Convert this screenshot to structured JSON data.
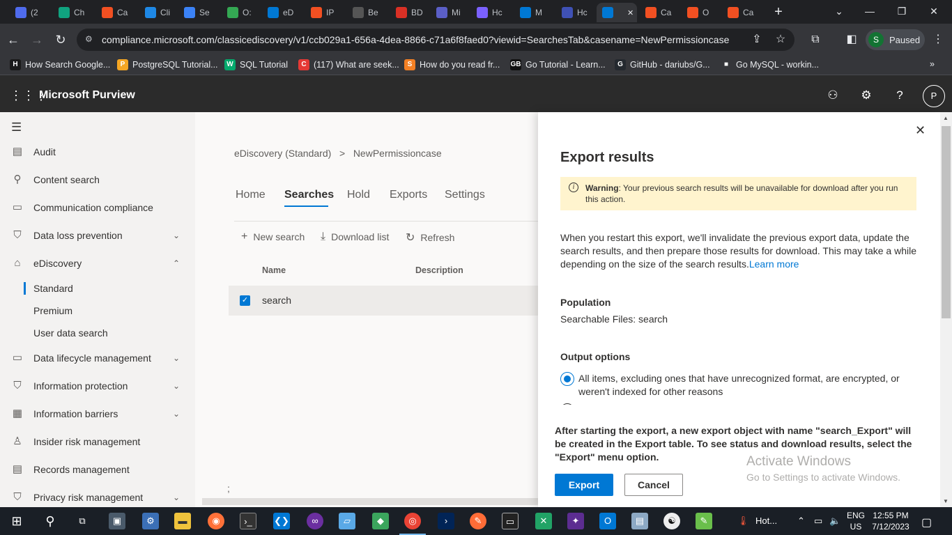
{
  "browser": {
    "tabs": [
      {
        "label": "(2",
        "color": "#4f6bed"
      },
      {
        "label": "Ch",
        "color": "#10a37f"
      },
      {
        "label": "Ca",
        "color": "#f25022"
      },
      {
        "label": "Cli",
        "color": "#1e88e5"
      },
      {
        "label": "Se",
        "color": "#3b82f6"
      },
      {
        "label": "O:",
        "color": "#34a853"
      },
      {
        "label": "eD",
        "color": "#0078d4"
      },
      {
        "label": "IP",
        "color": "#f25022"
      },
      {
        "label": "Be",
        "color": "#555555"
      },
      {
        "label": "BD",
        "color": "#d93025"
      },
      {
        "label": "Mi",
        "color": "#5b5fc7"
      },
      {
        "label": "Hc",
        "color": "#7b61ff"
      },
      {
        "label": "M",
        "color": "#0078d4"
      },
      {
        "label": "Hc",
        "color": "#3f51b5"
      },
      {
        "label": "",
        "color": "#0078d4"
      },
      {
        "label": "Ca",
        "color": "#f25022"
      },
      {
        "label": "O",
        "color": "#f25022"
      },
      {
        "label": "Ca",
        "color": "#f25022"
      }
    ],
    "url": "compliance.microsoft.com/classicediscovery/v1/ccb029a1-656a-4dea-8866-c71a6f8faed0?viewid=SearchesTab&casename=NewPermissioncase",
    "profile": {
      "initial": "S",
      "label": "Paused"
    },
    "bookmarks": [
      {
        "label": "How Search Google...",
        "icon": "H",
        "color": "#1a1a1a"
      },
      {
        "label": "PostgreSQL Tutorial...",
        "icon": "P",
        "color": "#f5a623"
      },
      {
        "label": "SQL Tutorial",
        "icon": "W",
        "color": "#04aa6d"
      },
      {
        "label": "(117) What are seek...",
        "icon": "C",
        "color": "#e53935"
      },
      {
        "label": "How do you read fr...",
        "icon": "S",
        "color": "#f48024"
      },
      {
        "label": "Go Tutorial - Learn...",
        "icon": "GB",
        "color": "#111111"
      },
      {
        "label": "GitHub - dariubs/G...",
        "icon": "G",
        "color": "#24292f"
      },
      {
        "label": "Go MySQL - workin...",
        "icon": "■",
        "color": "#35363a"
      }
    ]
  },
  "app": {
    "title": "Microsoft Purview",
    "avatar": "P"
  },
  "nav": {
    "items": [
      {
        "label": "Audit",
        "icon": "audit-icon",
        "glyph": "▤"
      },
      {
        "label": "Content search",
        "icon": "search-icon",
        "glyph": "⚲"
      },
      {
        "label": "Communication compliance",
        "icon": "chat-icon",
        "glyph": "▭"
      },
      {
        "label": "Data loss prevention",
        "icon": "shield-icon",
        "glyph": "⛉"
      },
      {
        "label": "eDiscovery",
        "icon": "courthouse-icon",
        "glyph": "⌂"
      },
      {
        "label": "Data lifecycle management",
        "icon": "archive-icon",
        "glyph": "▭"
      },
      {
        "label": "Information protection",
        "icon": "lock-icon",
        "glyph": "⛉"
      },
      {
        "label": "Information barriers",
        "icon": "barrier-icon",
        "glyph": "▦"
      },
      {
        "label": "Insider risk management",
        "icon": "person-icon",
        "glyph": "♙"
      },
      {
        "label": "Records management",
        "icon": "records-icon",
        "glyph": "▤"
      },
      {
        "label": "Privacy risk management",
        "icon": "privacy-icon",
        "glyph": "⛉"
      }
    ],
    "ediscovery_sub": [
      "Standard",
      "Premium",
      "User data search"
    ]
  },
  "main": {
    "breadcrumb": {
      "root": "eDiscovery (Standard)",
      "sep": ">",
      "current": "NewPermissioncase"
    },
    "tabs": [
      "Home",
      "Searches",
      "Hold",
      "Exports",
      "Settings"
    ],
    "commands": {
      "new": "New search",
      "download": "Download list",
      "refresh": "Refresh"
    },
    "columns": {
      "name": "Name",
      "description": "Description"
    },
    "rows": [
      {
        "name": "search"
      }
    ],
    "footnote": ";"
  },
  "panel": {
    "title": "Export results",
    "warning_label": "Warning",
    "warning_text": ": Your previous search results will be unavailable for download after you run this action.",
    "description": "When you restart this export, we'll invalidate the previous export data, update the search results, and then prepare those results for download. This may take a while depending on the size of the search results.",
    "learn_more": "Learn more",
    "population_heading": "Population",
    "population_value": "Searchable Files: search",
    "output_heading": "Output options",
    "option1": "All items, excluding ones that have unrecognized format, are encrypted, or weren't indexed for other reasons",
    "footer_text": "After starting the export, a new export object with name \"search_Export\" will be created in the Export table. To see status and download results, select the \"Export\" menu option.",
    "export_label": "Export",
    "cancel_label": "Cancel"
  },
  "watermark": {
    "line1": "Activate Windows",
    "line2": "Go to Settings to activate Windows."
  },
  "taskbar": {
    "lang1": "ENG",
    "lang2": "US",
    "time": "12:55 PM",
    "date": "7/12/2023",
    "weather": "Hot..."
  }
}
